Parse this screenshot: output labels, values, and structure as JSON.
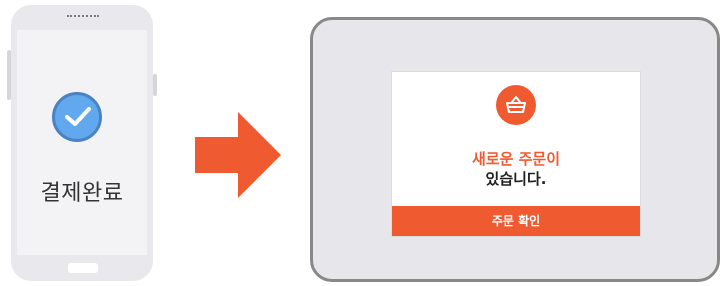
{
  "phone": {
    "status_icon": "check-circle-icon",
    "label": "결제완료"
  },
  "arrow": {
    "icon": "arrow-right-icon",
    "color": "#f05a30"
  },
  "tablet": {
    "dialog": {
      "icon": "shopping-basket-icon",
      "title": "새로운 주문이",
      "message": "있습니다.",
      "button_label": "주문 확인"
    }
  },
  "colors": {
    "accent": "#f05a30",
    "check_blue": "#61a8ee",
    "device_gray": "#e9e8ec",
    "tablet_border": "#888888"
  }
}
